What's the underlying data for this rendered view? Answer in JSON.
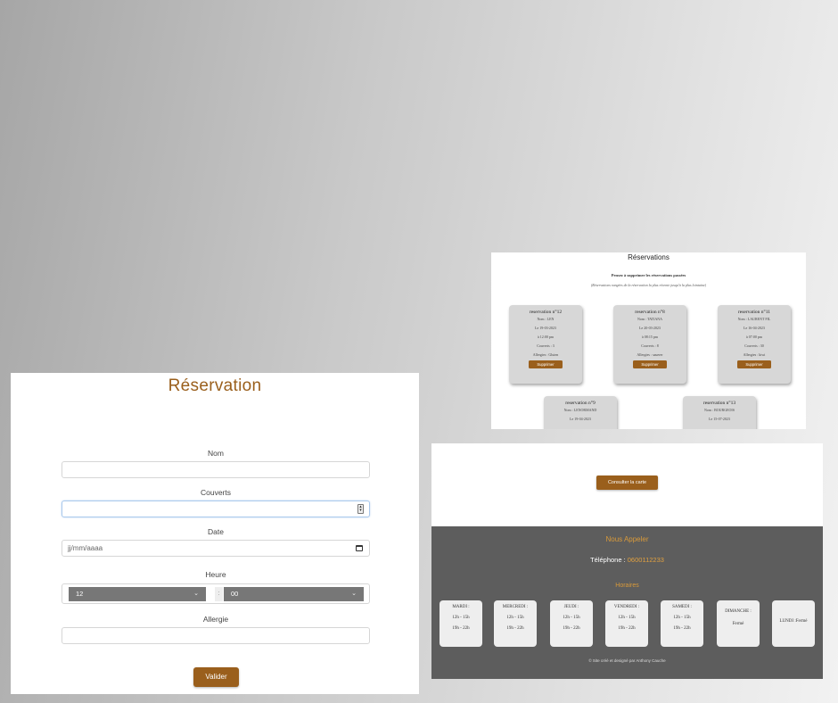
{
  "reservation_form": {
    "title": "Réservation",
    "name_label": "Nom",
    "name_value": "",
    "covers_label": "Couverts",
    "covers_value": "",
    "date_label": "Date",
    "date_placeholder": "jj/mm/aaaa",
    "time_label": "Heure",
    "hour_value": "12",
    "time_separator": ":",
    "minute_value": "00",
    "allergy_label": "Allergie",
    "allergy_value": "",
    "submit_label": "Valider"
  },
  "reservations_page": {
    "title": "Réservations",
    "subtitle": "Pensez à supprimer les réservations passées",
    "note": "(Réservations rangées de la réservation la plus récente jusqu'à la plus lointaine)",
    "delete_label": "Supprimer",
    "cards": [
      {
        "title": "reservation n°12",
        "name": "Nom : LEN",
        "date": "Le 19-03-2023",
        "time": "à 12:00 pm",
        "covers": "Couverts : 3",
        "allergies": "Allergies : Gluten"
      },
      {
        "title": "reservation n°8",
        "name": "Nom : TATIANA",
        "date": "Le 20-03-2023",
        "time": "à 08:15 pm",
        "covers": "Couverts : 8",
        "allergies": "Allergies : sauerer"
      },
      {
        "title": "reservation n°11",
        "name": "Nom : LAURENT FIL",
        "date": "Le 16-04-2023",
        "time": "à 07:00 pm",
        "covers": "Couverts : 30",
        "allergies": "Allergies : kiwi"
      },
      {
        "title": "reservation n°9",
        "name": "Nom : LENORMAND",
        "date": "Le 19-04-2023"
      },
      {
        "title": "reservation n°13",
        "name": "Nom : BOURGEOIS",
        "date": "Le 15-07-2023"
      }
    ]
  },
  "footer_page": {
    "menu_button": "Consulter la carte",
    "call_heading": "Nous Appeler",
    "phone_label": "Téléphone : ",
    "phone_number": "0600112233",
    "hours_heading": "Horaires",
    "days": [
      {
        "name": "MARDI :",
        "slot1": "12h - 15h",
        "slot2": "19h - 22h"
      },
      {
        "name": "MERCREDI :",
        "slot1": "12h - 15h",
        "slot2": "19h - 22h"
      },
      {
        "name": "JEUDI :",
        "slot1": "12h - 15h",
        "slot2": "19h - 22h"
      },
      {
        "name": "VENDREDI :",
        "slot1": "12h - 15h",
        "slot2": "19h - 22h"
      },
      {
        "name": "SAMEDI :",
        "slot1": "12h - 15h",
        "slot2": "19h - 22h"
      },
      {
        "name": "DIMANCHE :",
        "slot1": "Fermé"
      },
      {
        "name": "LUNDI :Fermé"
      }
    ],
    "copyright": "© Site créé et designé par Anthony Cauche"
  }
}
